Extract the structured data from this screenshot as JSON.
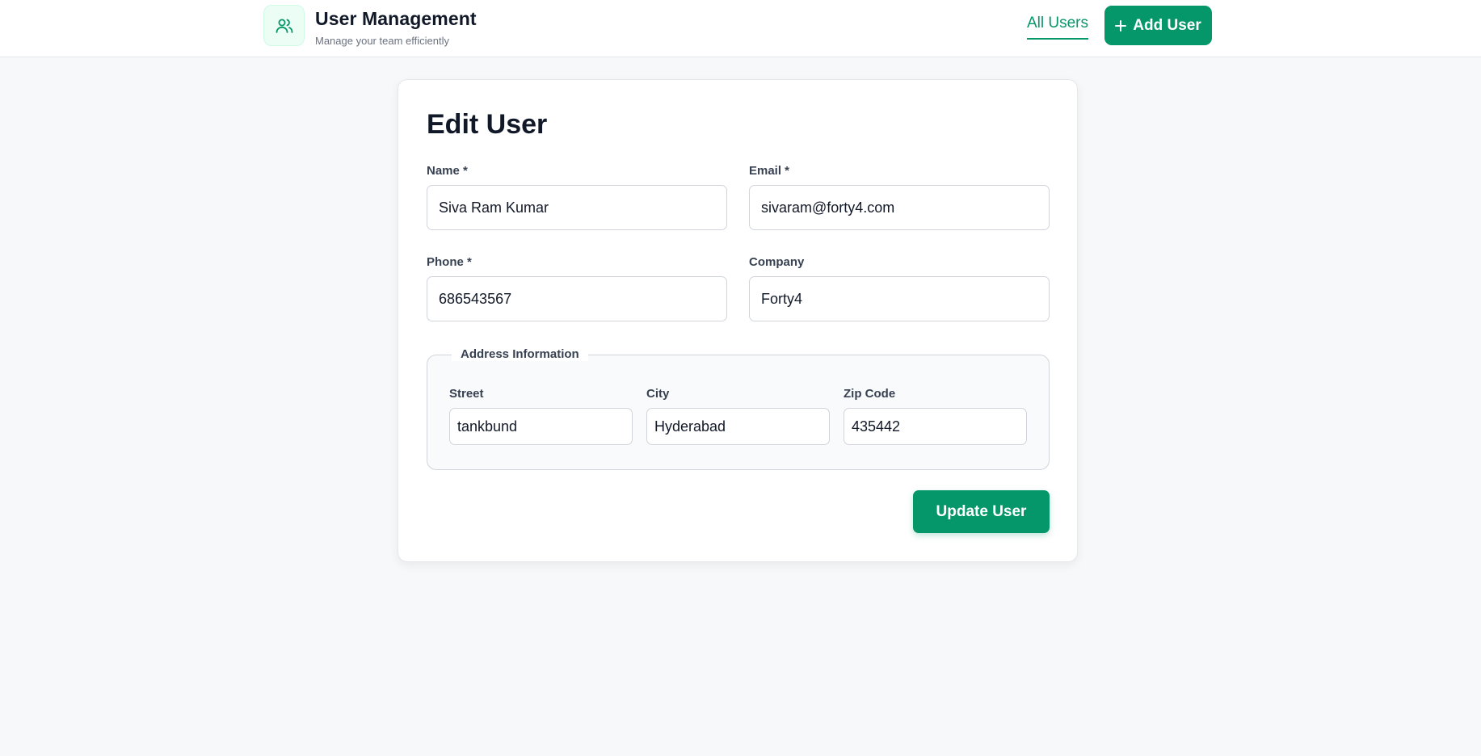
{
  "header": {
    "title": "User Management",
    "subtitle": "Manage your team efficiently",
    "nav_all_users": "All Users",
    "add_user_label": "Add User"
  },
  "form": {
    "title": "Edit User",
    "name": {
      "label": "Name *",
      "value": "Siva Ram Kumar"
    },
    "email": {
      "label": "Email *",
      "value": "sivaram@forty4.com"
    },
    "phone": {
      "label": "Phone *",
      "value": "686543567"
    },
    "company": {
      "label": "Company",
      "value": "Forty4"
    },
    "address": {
      "legend": "Address Information",
      "street": {
        "label": "Street",
        "value": "tankbund"
      },
      "city": {
        "label": "City",
        "value": "Hyderabad"
      },
      "zip": {
        "label": "Zip Code",
        "value": "435442"
      }
    },
    "submit_label": "Update User"
  },
  "icons": {
    "brand": "users-icon",
    "add": "plus-icon"
  },
  "colors": {
    "accent": "#059669",
    "background": "#f7f8fa"
  }
}
